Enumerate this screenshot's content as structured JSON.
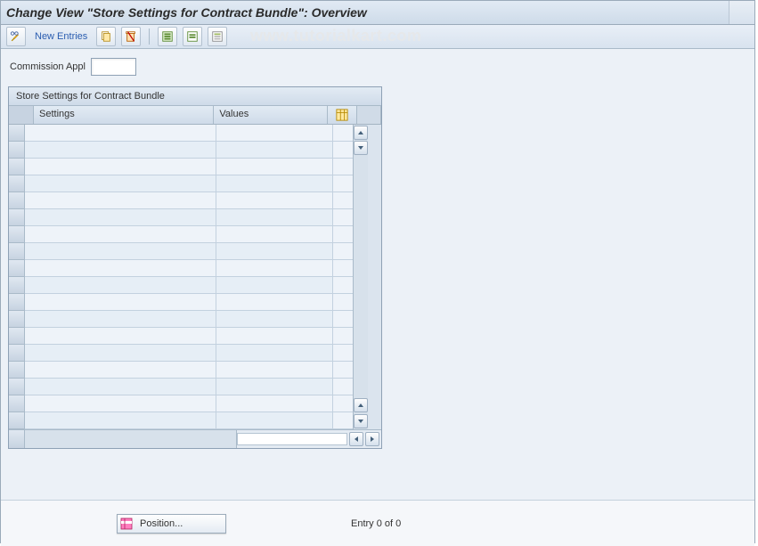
{
  "header": {
    "title": "Change View \"Store Settings for Contract Bundle\": Overview"
  },
  "toolbar": {
    "new_entries_label": "New Entries"
  },
  "watermark": "www.tutorialkart.com",
  "field": {
    "commission_appl_label": "Commission Appl",
    "commission_appl_value": ""
  },
  "grid": {
    "title": "Store Settings for Contract Bundle",
    "columns": {
      "settings": "Settings",
      "values": "Values"
    },
    "rows": [
      {
        "settings": "",
        "values": ""
      },
      {
        "settings": "",
        "values": ""
      },
      {
        "settings": "",
        "values": ""
      },
      {
        "settings": "",
        "values": ""
      },
      {
        "settings": "",
        "values": ""
      },
      {
        "settings": "",
        "values": ""
      },
      {
        "settings": "",
        "values": ""
      },
      {
        "settings": "",
        "values": ""
      },
      {
        "settings": "",
        "values": ""
      },
      {
        "settings": "",
        "values": ""
      },
      {
        "settings": "",
        "values": ""
      },
      {
        "settings": "",
        "values": ""
      },
      {
        "settings": "",
        "values": ""
      },
      {
        "settings": "",
        "values": ""
      },
      {
        "settings": "",
        "values": ""
      },
      {
        "settings": "",
        "values": ""
      },
      {
        "settings": "",
        "values": ""
      },
      {
        "settings": "",
        "values": ""
      }
    ]
  },
  "bottom": {
    "position_label": "Position...",
    "entry_count": "Entry 0 of 0"
  },
  "icons": {
    "toggle": "display-change-icon",
    "copy": "copy-icon",
    "delete": "delete-icon",
    "select_all": "select-all-icon",
    "select_block": "select-block-icon",
    "deselect_all": "deselect-all-icon"
  }
}
